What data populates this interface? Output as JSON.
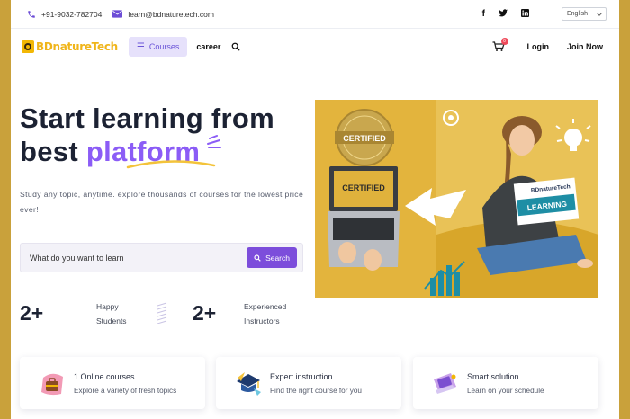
{
  "topbar": {
    "phone": "+91-9032-782704",
    "email": "learn@bdnaturetech.com",
    "language": "English",
    "social": [
      "facebook-icon",
      "twitter-icon",
      "linkedin-icon"
    ]
  },
  "nav": {
    "logo_text": "BDnatureTech",
    "courses_label": "Courses",
    "career_label": "career",
    "cart_count": "0",
    "login_label": "Login",
    "join_label": "Join Now"
  },
  "hero": {
    "title_line1": "Start learning from",
    "title_line2_prefix": "best ",
    "title_accent": "platform",
    "subtitle": "Study any topic, anytime. explore thousands of courses for the lowest price ever!",
    "search_placeholder": "What do you want to learn",
    "search_button": "Search",
    "image": {
      "badge_text": "CERTIFIED",
      "laptop_text": "CERTIFIED",
      "book_brand": "BDnatureTech",
      "book_label": "LEARNING"
    }
  },
  "stats": [
    {
      "value": "2+",
      "line1": "Happy",
      "line2": "Students"
    },
    {
      "value": "2+",
      "line1": "Experienced",
      "line2": "Instructors"
    }
  ],
  "features": [
    {
      "title": "1 Online courses",
      "desc": "Explore a variety of fresh topics",
      "icon": "online-courses-icon"
    },
    {
      "title": "Expert instruction",
      "desc": "Find the right course for you",
      "icon": "expert-instruction-icon"
    },
    {
      "title": "Smart solution",
      "desc": "Learn on your schedule",
      "icon": "smart-solution-icon"
    }
  ],
  "colors": {
    "accent": "#8b5cf6",
    "button": "#7c4ddb",
    "frame": "#c9a13b",
    "logo": "#f0b51a"
  }
}
